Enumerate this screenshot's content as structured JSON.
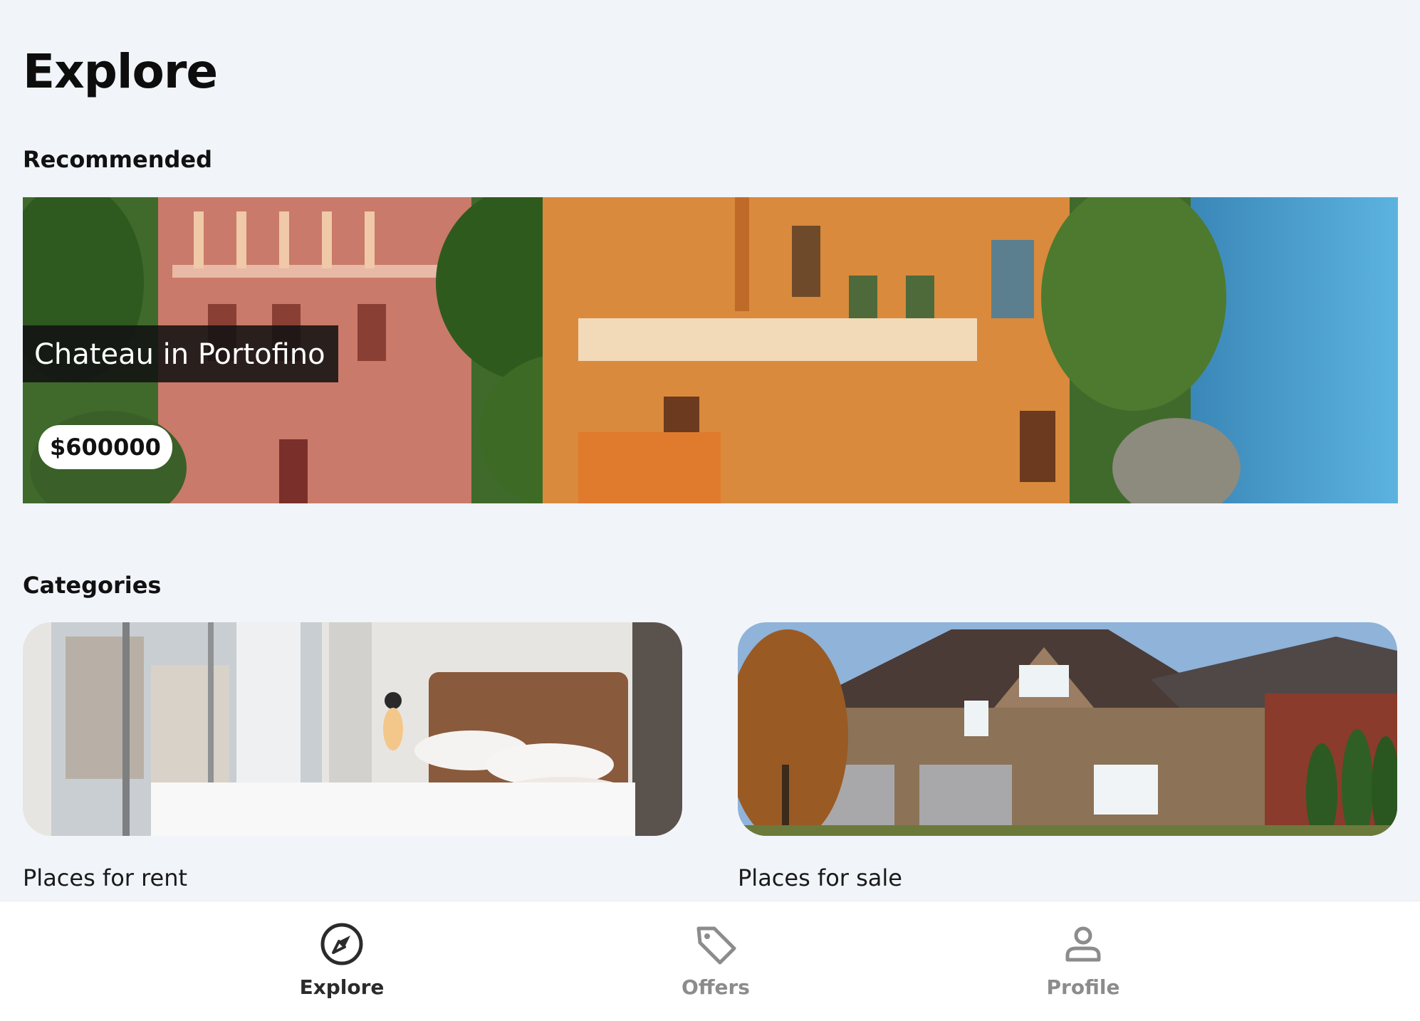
{
  "page": {
    "title": "Explore"
  },
  "recommended": {
    "heading": "Recommended",
    "item": {
      "title": "Chateau in Portofino",
      "price": "$600000"
    }
  },
  "categories": {
    "heading": "Categories",
    "items": [
      {
        "label": "Places for rent"
      },
      {
        "label": "Places for sale"
      }
    ]
  },
  "nav": {
    "items": [
      {
        "label": "Explore",
        "icon": "compass-icon",
        "active": true
      },
      {
        "label": "Offers",
        "icon": "tag-icon",
        "active": false
      },
      {
        "label": "Profile",
        "icon": "user-icon",
        "active": false
      }
    ]
  },
  "colors": {
    "background": "#f1f4f9",
    "active_nav": "#2b2b2b",
    "inactive_nav": "#8c8c8c"
  }
}
